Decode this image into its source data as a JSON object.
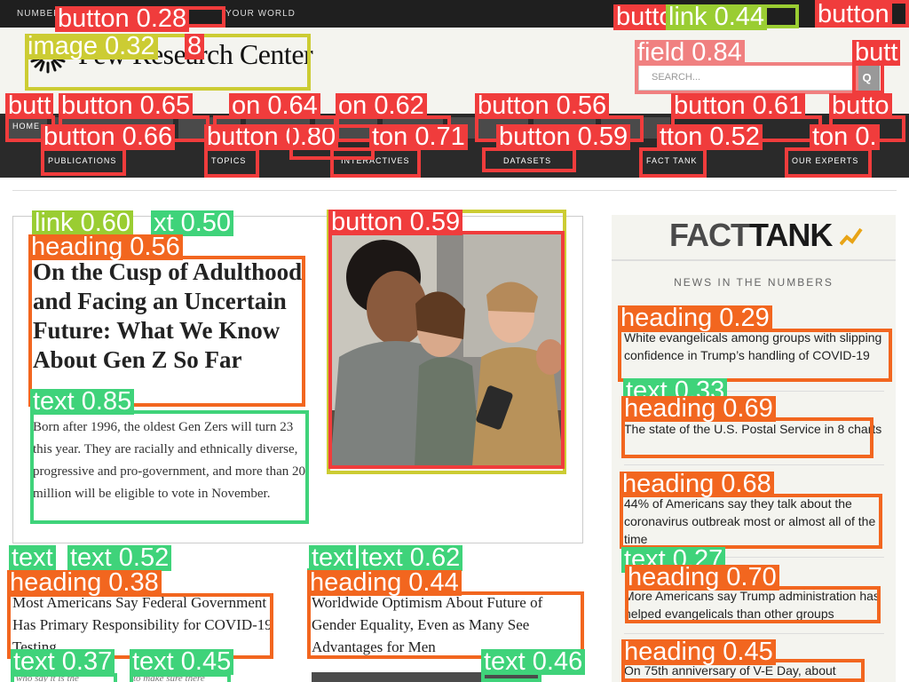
{
  "topbar": {
    "tagline_left": "NUMBERS,",
    "tagline_right": "YOUR WORLD"
  },
  "header": {
    "logo_text": "Pew Research Center",
    "search_placeholder": "SEARCH...",
    "search_button": "Q"
  },
  "nav": {
    "row1": [
      "HOME",
      "",
      "",
      "",
      "",
      "",
      "",
      "",
      ""
    ],
    "row2": [
      "PUBLICATIONS",
      "TOPICS",
      "INTERACTIVES",
      "DATASETS",
      "FACT TANK",
      "OUR EXPERTS"
    ]
  },
  "feature": {
    "kicker": "",
    "headline": "On the Cusp of Adulthood and Facing an Uncertain Future: What We Know About Gen Z So Far",
    "body": "Born after 1996, the oldest Gen Zers will turn 23 this year. They are racially and ethnically diverse, progressive and pro-government, and more than 20 million will be eligible to vote in November."
  },
  "sidebar": {
    "brand_fact": "FACT",
    "brand_tank": "TANK",
    "subtitle": "NEWS IN THE NUMBERS",
    "stories": [
      "White evangelicals among groups with slipping confidence in Trump’s handling of COVID-19",
      "The state of the U.S. Postal Service in 8 charts",
      "44% of Americans say they talk about the coronavirus outbreak most or almost all of the time",
      "More Americans say Trump administration has helped evangelicals than other groups",
      "On 75th anniversary of V-E Day, about"
    ]
  },
  "bottom": {
    "story_left": "Most Americans Say Federal Government Has Primary Responsibility for COVID-19 Testing",
    "story_mid": "Worldwide Optimism About Future of Gender Equality, Even as Many See Advantages for Men",
    "sub_left_a": "who say it is the",
    "sub_left_b": "to make sure there"
  },
  "overlay": {
    "colors": {
      "button": "#f03c3c",
      "link": "#9acd32",
      "field": "#f08080",
      "image": "#cccc33",
      "heading": "#f2661f",
      "text": "#3fd37a"
    },
    "labels": [
      "button 0.28",
      "button 0.",
      "button 0.",
      "link 0.44",
      "button",
      "field 0.84",
      "butt",
      "image 0.32",
      "8",
      "butt",
      "button 0.65",
      "on 0.64",
      "on 0.62",
      "button 0.56",
      "button 0.61",
      "butto",
      "button 0.66",
      "button 0.80",
      "ton 0.71",
      "button 0.59",
      "tton 0.52",
      "ton 0.",
      "link 0.60",
      "xt 0.50",
      "heading 0.56",
      "text 0.85",
      "button 0.59",
      "heading 0.29",
      "text 0.33",
      "heading 0.69",
      "heading 0.68",
      "text 0.27",
      "heading 0.70",
      "heading 0.45",
      "text",
      "text 0.52",
      "heading 0.38",
      "text",
      "text 0.62",
      "heading 0.44",
      "text 0.37",
      "text 0.45",
      "text 0.46"
    ]
  }
}
